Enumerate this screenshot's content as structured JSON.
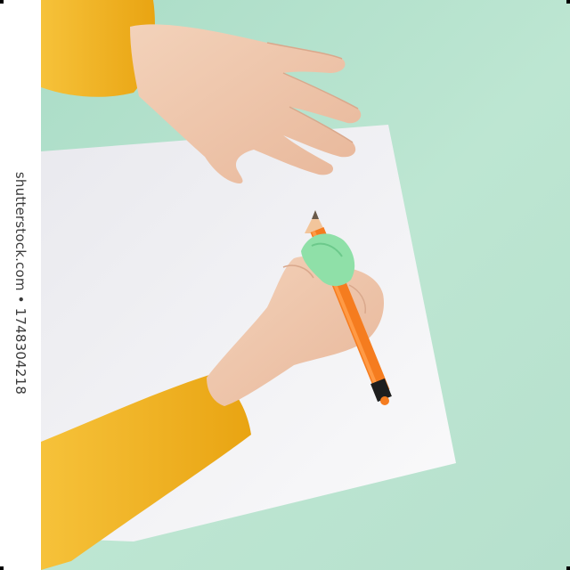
{
  "watermark": {
    "text": "shutterstock.com • 1748304218"
  },
  "colors": {
    "background": "#bfe6d3",
    "paper": "#f4f4f6",
    "sleeve": "#f2b21c",
    "skin": "#f0c8ae",
    "pencil": "#f57c1f",
    "grip": "#8fe0a8"
  }
}
